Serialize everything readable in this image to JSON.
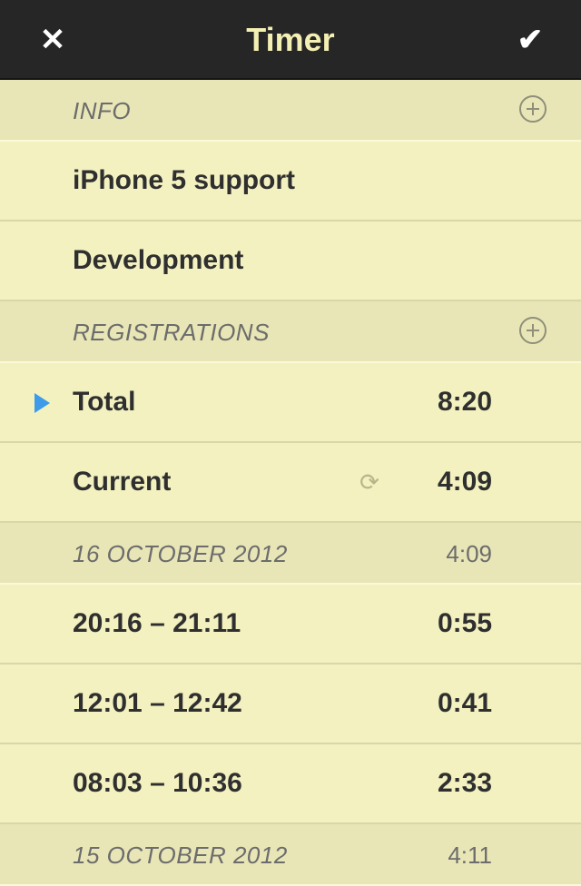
{
  "header": {
    "title": "Timer",
    "close_icon": "close-icon",
    "done_icon": "checkmark-icon",
    "close_glyph": "✕",
    "done_glyph": "✔"
  },
  "info": {
    "section_label": "INFO",
    "items": [
      "iPhone 5 support",
      "Development"
    ]
  },
  "registrations": {
    "section_label": "REGISTRATIONS",
    "total": {
      "label": "Total",
      "value": "8:20"
    },
    "current": {
      "label": "Current",
      "value": "4:09",
      "icon": "sync-icon",
      "glyph": "⟳"
    }
  },
  "days": [
    {
      "date": "16 OCTOBER 2012",
      "total": "4:09",
      "entries": [
        {
          "range": "20:16 – 21:11",
          "duration": "0:55"
        },
        {
          "range": "12:01 – 12:42",
          "duration": "0:41"
        },
        {
          "range": "08:03 – 10:36",
          "duration": "2:33"
        }
      ]
    },
    {
      "date": "15 OCTOBER 2012",
      "total": "4:11",
      "entries": []
    }
  ],
  "colors": {
    "background": "#f3f1c0",
    "section_background": "#e8e6b6",
    "topbar": "#262626",
    "title": "#f4efb2",
    "accent_arrow": "#3d9be9"
  }
}
